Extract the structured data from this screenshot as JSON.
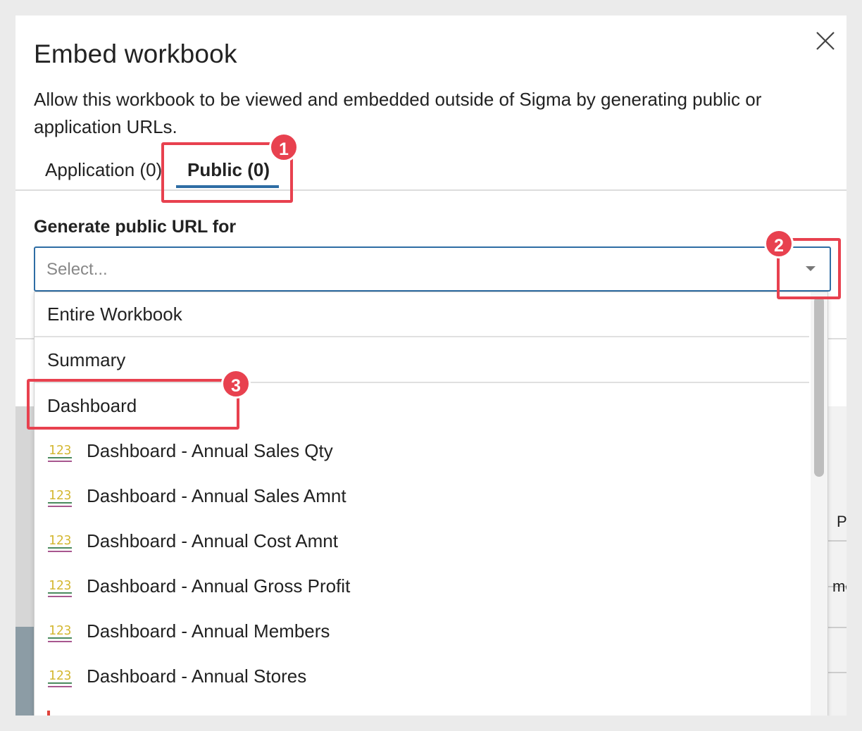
{
  "dialog": {
    "title": "Embed workbook",
    "description": "Allow this workbook to be viewed and embedded outside of Sigma by generating public or application URLs.",
    "close_icon": "close-icon"
  },
  "tabs": [
    {
      "label": "Application (0)",
      "active": false
    },
    {
      "label": "Public (0)",
      "active": true
    }
  ],
  "form": {
    "label": "Generate public URL for",
    "placeholder": "Select..."
  },
  "options": [
    {
      "label": "Entire Workbook",
      "icon": null
    },
    {
      "label": "Summary",
      "icon": null
    },
    {
      "label": "Dashboard",
      "icon": null
    },
    {
      "label": "Dashboard - Annual Sales Qty",
      "icon": "number-kpi-icon"
    },
    {
      "label": "Dashboard - Annual Sales Amnt",
      "icon": "number-kpi-icon"
    },
    {
      "label": "Dashboard - Annual Cost Amnt",
      "icon": "number-kpi-icon"
    },
    {
      "label": "Dashboard - Annual Gross Profit",
      "icon": "number-kpi-icon"
    },
    {
      "label": "Dashboard - Annual Members",
      "icon": "number-kpi-icon"
    },
    {
      "label": "Dashboard - Annual Stores",
      "icon": "number-kpi-icon"
    }
  ],
  "icon_text": "123",
  "annotations": [
    "1",
    "2",
    "3"
  ],
  "background_fragments": [
    "P",
    "me"
  ],
  "colors": {
    "accent": "#2e6da4",
    "annotation": "#e8414f",
    "icon_yellow": "#d4b833",
    "icon_green": "#4a8a5e",
    "icon_purple": "#a8578f"
  }
}
